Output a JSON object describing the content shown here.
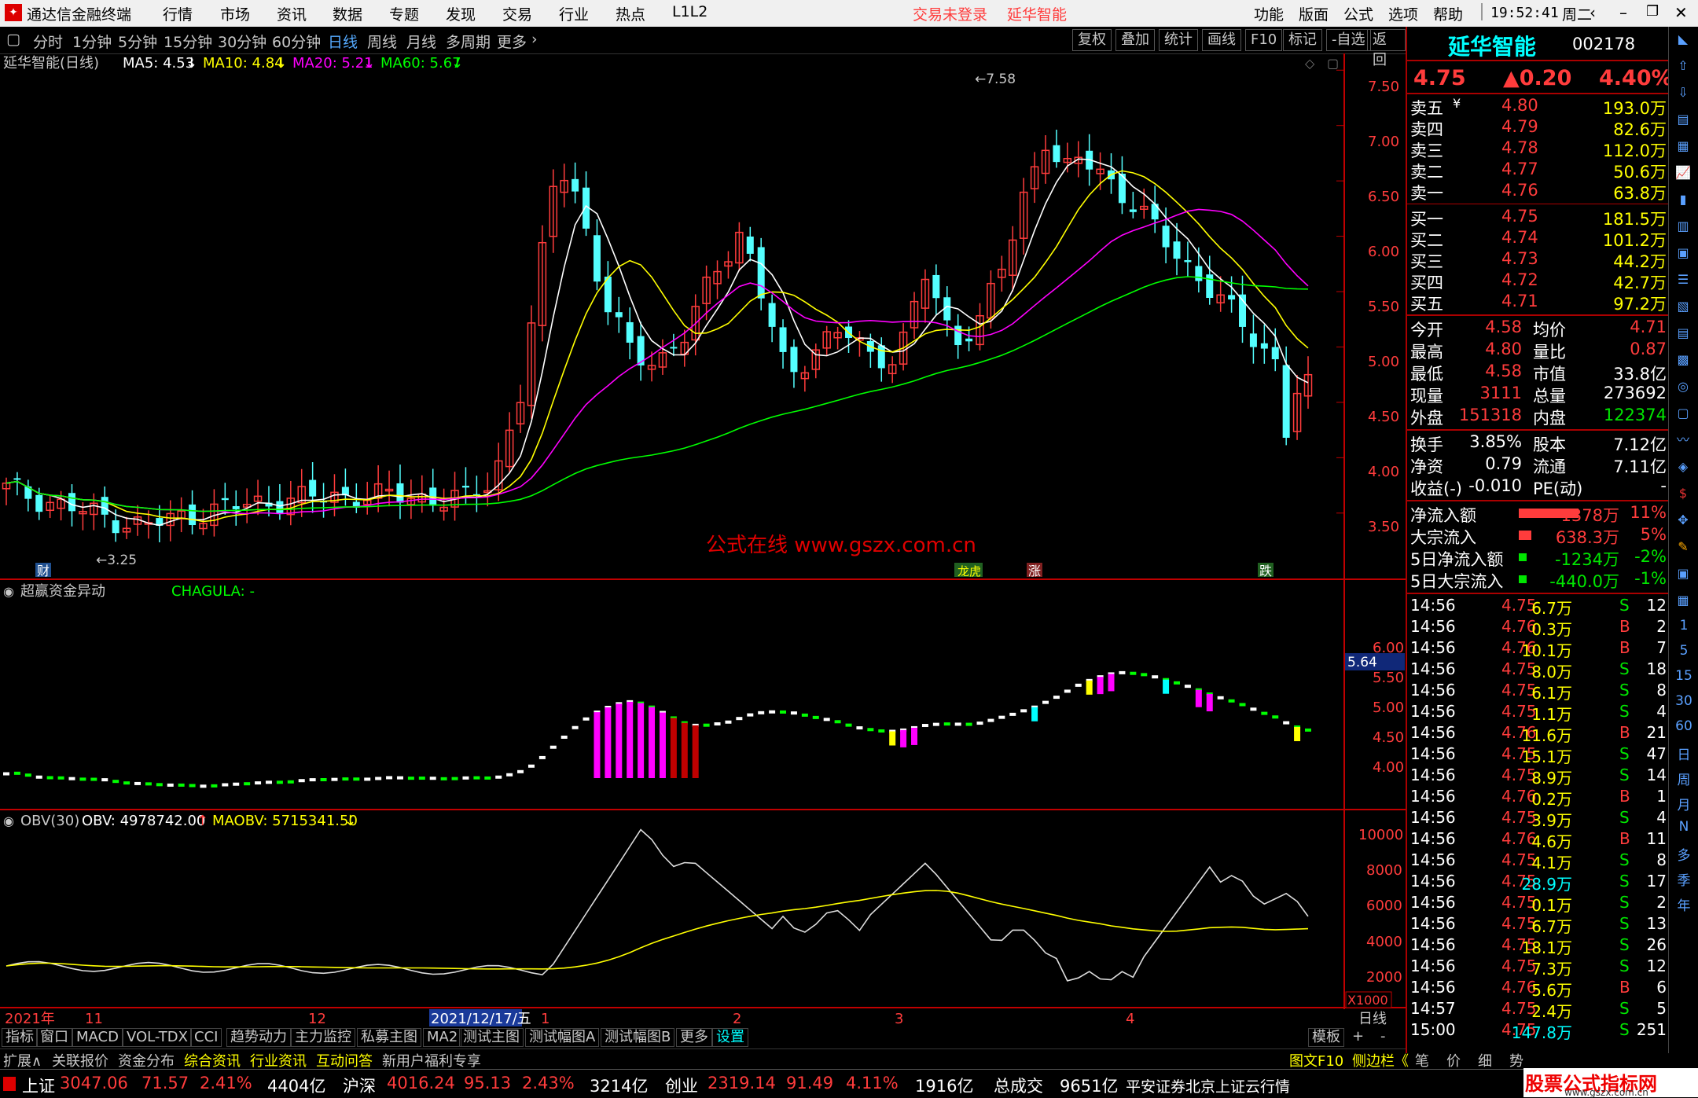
{
  "app": {
    "title": "通达信金融终端",
    "menu": [
      "行情",
      "市场",
      "资讯",
      "数据",
      "专题",
      "发现",
      "交易",
      "行业",
      "热点",
      "L1L2"
    ],
    "login_status": "交易未登录",
    "stock_title": "延华智能",
    "right_menu": [
      "功能",
      "版面",
      "公式",
      "选项",
      "帮助"
    ],
    "clock": "19:52:41",
    "weekday": "周二"
  },
  "periods": [
    "分时",
    "1分钟",
    "5分钟",
    "15分钟",
    "30分钟",
    "60分钟",
    "日线",
    "周线",
    "月线",
    "多周期",
    "更多"
  ],
  "active_period": "日线",
  "toolbar": [
    "复权",
    "叠加",
    "统计",
    "画线",
    "F10",
    "标记",
    "-自选",
    "返回"
  ],
  "main_chart": {
    "header": "延华智能(日线)",
    "ma5": "MA5: 4.53",
    "ma10": "MA10: 4.84",
    "ma20": "MA20: 5.21",
    "ma60": "MA60: 5.67",
    "high_label": "7.58",
    "low_label": "3.25",
    "watermark": "公式在线  www.gszx.com.cn",
    "markers": [
      "财",
      "涨",
      "跌",
      "涨"
    ],
    "y_ticks": [
      "7.50",
      "7.00",
      "6.50",
      "6.00",
      "5.50",
      "5.00",
      "4.50",
      "4.00",
      "3.50"
    ],
    "ylim": [
      3.25,
      7.58
    ]
  },
  "indicator1": {
    "name": "超赢资金异动",
    "param": "CHAGULA: -",
    "current": "5.64",
    "y_ticks": [
      "6.00",
      "5.50",
      "5.00",
      "4.50",
      "4.00"
    ]
  },
  "indicator2": {
    "name": "OBV(30)",
    "obv": "OBV: 4978742.00",
    "maobv": "MAOBV: 5715341.50",
    "y_ticks": [
      "10000",
      "8000",
      "6000",
      "4000",
      "2000"
    ],
    "unit": "X1000"
  },
  "x_axis": {
    "labels": [
      "2021年",
      "11",
      "12",
      "2021/12/17/五",
      "1",
      "2",
      "3",
      "4"
    ],
    "period_label": "日线"
  },
  "bottom_tabs": [
    "指标",
    "窗口",
    "MACD",
    "VOL-TDX",
    "CCI",
    "趋势动力",
    "主力监控",
    "私募主图",
    "MA2",
    "测试主图",
    "测试幅图A",
    "测试幅图B",
    "更多",
    "设置"
  ],
  "bottom_right": [
    "模板",
    "+",
    "-"
  ],
  "tabs2": [
    "扩展∧",
    "关联报价",
    "资金分布",
    "综合资讯",
    "行业资讯",
    "互动问答",
    "新用户福利专享"
  ],
  "tabs2_right": [
    "图文F10",
    "侧边栏《",
    "笔",
    "价",
    "细",
    "势"
  ],
  "quote": {
    "name": "延华智能",
    "code": "002178",
    "price": "4.75",
    "change": "▲0.20",
    "pct": "4.40%",
    "asks": [
      {
        "label": "卖五",
        "price": "4.80",
        "vol": "193.0万"
      },
      {
        "label": "卖四",
        "price": "4.79",
        "vol": "82.6万"
      },
      {
        "label": "卖三",
        "price": "4.78",
        "vol": "112.0万"
      },
      {
        "label": "卖二",
        "price": "4.77",
        "vol": "50.6万"
      },
      {
        "label": "卖一",
        "price": "4.76",
        "vol": "63.8万"
      }
    ],
    "bids": [
      {
        "label": "买一",
        "price": "4.75",
        "vol": "181.5万"
      },
      {
        "label": "买二",
        "price": "4.74",
        "vol": "101.2万"
      },
      {
        "label": "买三",
        "price": "4.73",
        "vol": "44.2万"
      },
      {
        "label": "买四",
        "price": "4.72",
        "vol": "42.7万"
      },
      {
        "label": "买五",
        "price": "4.71",
        "vol": "97.2万"
      }
    ],
    "stats": [
      {
        "l1": "今开",
        "v1": "4.58",
        "l2": "均价",
        "v2": "4.71"
      },
      {
        "l1": "最高",
        "v1": "4.80",
        "l2": "量比",
        "v2": "0.87"
      },
      {
        "l1": "最低",
        "v1": "4.58",
        "l2": "市值",
        "v2": "33.8亿"
      },
      {
        "l1": "现量",
        "v1": "3111",
        "l2": "总量",
        "v2": "273692"
      },
      {
        "l1": "外盘",
        "v1": "151318",
        "l2": "内盘",
        "v2": "122374"
      }
    ],
    "stats2": [
      {
        "l1": "换手",
        "v1": "3.85%",
        "l2": "股本",
        "v2": "7.12亿"
      },
      {
        "l1": "净资",
        "v1": "0.79",
        "l2": "流通",
        "v2": "7.11亿"
      },
      {
        "l1": "收益(-)",
        "v1": "-0.010",
        "l2": "PE(动)",
        "v2": "-"
      }
    ],
    "flows": [
      {
        "label": "净流入额",
        "value": "1378万",
        "pct": "11%"
      },
      {
        "label": "大宗流入",
        "value": "638.3万",
        "pct": "5%"
      },
      {
        "label": "5日净流入额",
        "value": "-1234万",
        "pct": "-2%"
      },
      {
        "label": "5日大宗流入",
        "value": "-440.0万",
        "pct": "-1%"
      }
    ],
    "trades": [
      {
        "t": "14:56",
        "p": "4.75",
        "v": "6.7万",
        "s": "S",
        "n": "12"
      },
      {
        "t": "14:56",
        "p": "4.76",
        "v": "0.3万",
        "s": "B",
        "n": "2"
      },
      {
        "t": "14:56",
        "p": "4.76",
        "v": "10.1万",
        "s": "B",
        "n": "7"
      },
      {
        "t": "14:56",
        "p": "4.75",
        "v": "8.0万",
        "s": "S",
        "n": "18"
      },
      {
        "t": "14:56",
        "p": "4.75",
        "v": "6.1万",
        "s": "S",
        "n": "8"
      },
      {
        "t": "14:56",
        "p": "4.75",
        "v": "1.1万",
        "s": "S",
        "n": "4"
      },
      {
        "t": "14:56",
        "p": "4.76",
        "v": "11.6万",
        "s": "B",
        "n": "21"
      },
      {
        "t": "14:56",
        "p": "4.75",
        "v": "15.1万",
        "s": "S",
        "n": "47"
      },
      {
        "t": "14:56",
        "p": "4.75",
        "v": "8.9万",
        "s": "S",
        "n": "14"
      },
      {
        "t": "14:56",
        "p": "4.76",
        "v": "0.2万",
        "s": "B",
        "n": "1"
      },
      {
        "t": "14:56",
        "p": "4.75",
        "v": "3.9万",
        "s": "S",
        "n": "4"
      },
      {
        "t": "14:56",
        "p": "4.76",
        "v": "4.6万",
        "s": "B",
        "n": "11"
      },
      {
        "t": "14:56",
        "p": "4.75",
        "v": "4.1万",
        "s": "S",
        "n": "8"
      },
      {
        "t": "14:56",
        "p": "4.75",
        "v": "28.9万",
        "s": "S",
        "n": "17"
      },
      {
        "t": "14:56",
        "p": "4.75",
        "v": "0.1万",
        "s": "S",
        "n": "2"
      },
      {
        "t": "14:56",
        "p": "4.75",
        "v": "6.7万",
        "s": "S",
        "n": "13"
      },
      {
        "t": "14:56",
        "p": "4.75",
        "v": "18.1万",
        "s": "S",
        "n": "26"
      },
      {
        "t": "14:56",
        "p": "4.75",
        "v": "7.3万",
        "s": "S",
        "n": "12"
      },
      {
        "t": "14:56",
        "p": "4.76",
        "v": "5.6万",
        "s": "B",
        "n": "6"
      },
      {
        "t": "14:57",
        "p": "4.75",
        "v": "2.4万",
        "s": "S",
        "n": "5"
      },
      {
        "t": "15:00",
        "p": "4.75",
        "v": "147.8万",
        "s": "S",
        "n": "251"
      }
    ],
    "side_chars": [
      "日",
      "周",
      "月",
      "N",
      "多",
      "季",
      "年"
    ],
    "side_nums": [
      "1",
      "5",
      "15",
      "30",
      "60"
    ]
  },
  "status": {
    "indices": [
      {
        "name": "上证",
        "val": "3047.06",
        "chg": "71.57",
        "pct": "2.41%",
        "amt": "4404亿"
      },
      {
        "name": "沪深",
        "val": "4016.24",
        "chg": "95.13",
        "pct": "2.43%",
        "amt": "3214亿"
      },
      {
        "name": "创业",
        "val": "2319.14",
        "chg": "91.49",
        "pct": "4.11%",
        "amt": "1916亿"
      }
    ],
    "total_label": "总成交",
    "total_val": "9651亿",
    "server": "平安证券北京上证云行情",
    "logo": "股票公式指标网",
    "logo_url": "www.gszx.com.cn"
  },
  "colors": {
    "up": "#ff3c3c",
    "down": "#54ffff",
    "ma5": "#ffffff",
    "ma10": "#ffff00",
    "ma20": "#ff00ff",
    "ma60": "#00ff00",
    "axis": "#c00000"
  }
}
